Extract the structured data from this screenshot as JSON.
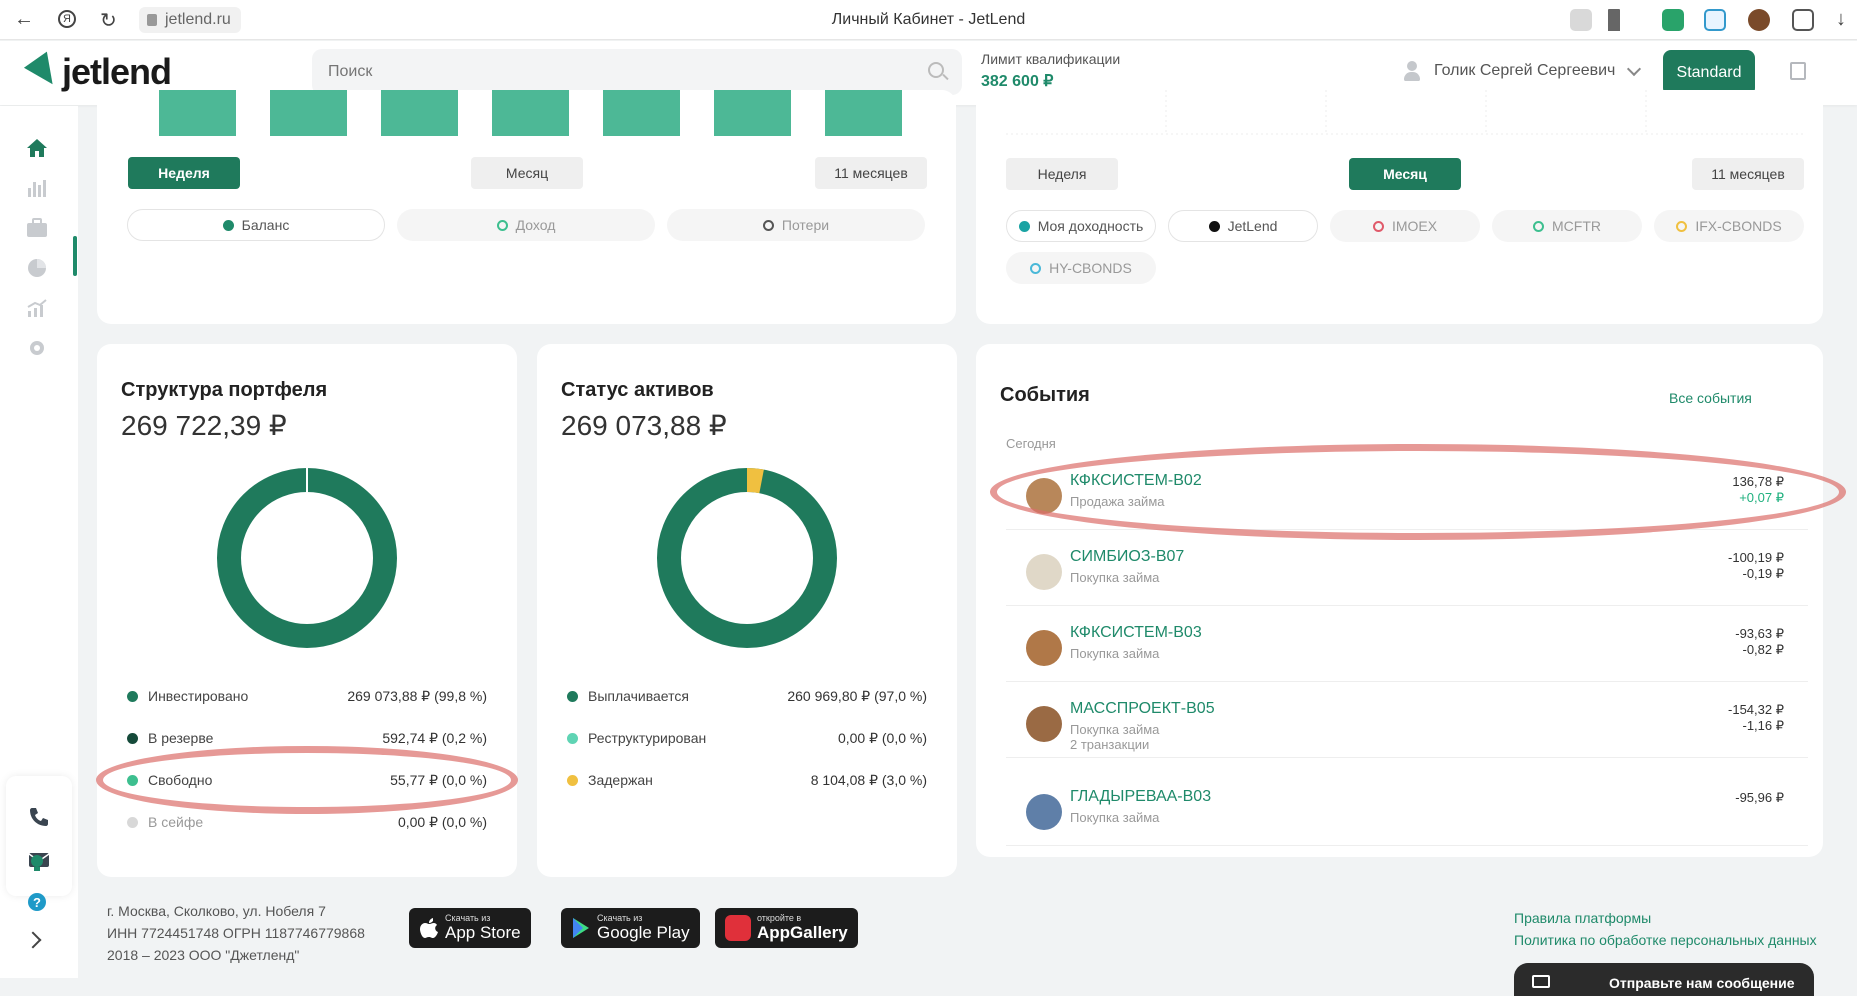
{
  "browser": {
    "url": "jetlend.ru",
    "tab_title": "Личный Кабинет - JetLend"
  },
  "header": {
    "logo": "jetlend",
    "search_placeholder": "Поиск",
    "limit_label": "Лимит квалификации",
    "limit_value": "382 600 ₽",
    "user_name": "Голик Сергей Сергеевич",
    "plan_button": "Standard"
  },
  "left_chart": {
    "periods": [
      "Неделя",
      "Месяц",
      "11 месяцев"
    ],
    "active_period": "Неделя",
    "legend": [
      {
        "label": "Баланс",
        "color": "#1f8a6a",
        "filled": true
      },
      {
        "label": "Доход",
        "color": "#3dbf8f",
        "filled": false
      },
      {
        "label": "Потери",
        "color": "#555555",
        "filled": false
      }
    ]
  },
  "right_chart": {
    "periods": [
      "Неделя",
      "Месяц",
      "11 месяцев"
    ],
    "active_period": "Месяц",
    "legend": [
      {
        "label": "Моя доходность",
        "color": "#1aa3a3",
        "filled": true
      },
      {
        "label": "JetLend",
        "color": "#111111",
        "filled": true
      },
      {
        "label": "IMOEX",
        "color": "#e05a6a",
        "filled": false
      },
      {
        "label": "MCFTR",
        "color": "#3dbf8f",
        "filled": false
      },
      {
        "label": "IFX-CBONDS",
        "color": "#f0c040",
        "filled": false
      },
      {
        "label": "HY-CBONDS",
        "color": "#4ab8d8",
        "filled": false
      }
    ]
  },
  "portfolio": {
    "title": "Структура портфеля",
    "amount": "269 722,39 ₽",
    "items": [
      {
        "label": "Инвестировано",
        "value": "269 073,88 ₽ (99,8 %)",
        "color": "#1f7a5c"
      },
      {
        "label": "В резерве",
        "value": "592,74 ₽ (0,2 %)",
        "color": "#154a3a"
      },
      {
        "label": "Свободно",
        "value": "55,77 ₽ (0,0 %)",
        "color": "#3dbf8f"
      },
      {
        "label": "В сейфе",
        "value": "0,00 ₽ (0,0 %)",
        "color": "#d8d8d8"
      }
    ],
    "donut_fraction": 0.998
  },
  "assets": {
    "title": "Статус активов",
    "amount": "269 073,88 ₽",
    "items": [
      {
        "label": "Выплачивается",
        "value": "260 969,80 ₽ (97,0 %)",
        "color": "#1f7a5c"
      },
      {
        "label": "Реструктурирован",
        "value": "0,00 ₽ (0,0 %)",
        "color": "#5fd4b4"
      },
      {
        "label": "Задержан",
        "value": "8 104,08 ₽ (3,0 %)",
        "color": "#f0c040"
      }
    ],
    "donut_fraction": 0.97
  },
  "events": {
    "title": "События",
    "all_link": "Все события",
    "section_label": "Сегодня",
    "items": [
      {
        "name": "КФКСИСТЕМ-В02",
        "type": "Продажа займа",
        "amount": "136,78 ₽",
        "delta": "+0,07 ₽"
      },
      {
        "name": "СИМБИОЗ-В07",
        "type": "Покупка займа",
        "amount": "-100,19 ₽",
        "delta": "-0,19 ₽"
      },
      {
        "name": "КФКСИСТЕМ-В03",
        "type": "Покупка займа",
        "amount": "-93,63 ₽",
        "delta": "-0,82 ₽"
      },
      {
        "name": "МАССПРОЕКТ-В05",
        "type": "Покупка займа",
        "extra": "2 транзакции",
        "amount": "-154,32 ₽",
        "delta": "-1,16 ₽"
      },
      {
        "name": "ГЛАДЫРЕВАА-В03",
        "type": "Покупка займа",
        "amount": "-95,96 ₽",
        "delta": ""
      }
    ]
  },
  "footer": {
    "address": "г. Москва, Сколково, ул. Нобеля 7",
    "inn": "ИНН 7724451748 ОГРН 1187746779868",
    "copyright": "2018 – 2023 ООО \"Джетленд\"",
    "stores": [
      {
        "small": "Скачать из",
        "big": "App Store"
      },
      {
        "small": "Скачать из",
        "big": "Google Play"
      },
      {
        "small": "откройте в",
        "big": "AppGallery"
      }
    ],
    "links": [
      "Правила платформы",
      "Политика по обработке персональных данных"
    ],
    "chat": "Отправьте нам сообщение"
  }
}
